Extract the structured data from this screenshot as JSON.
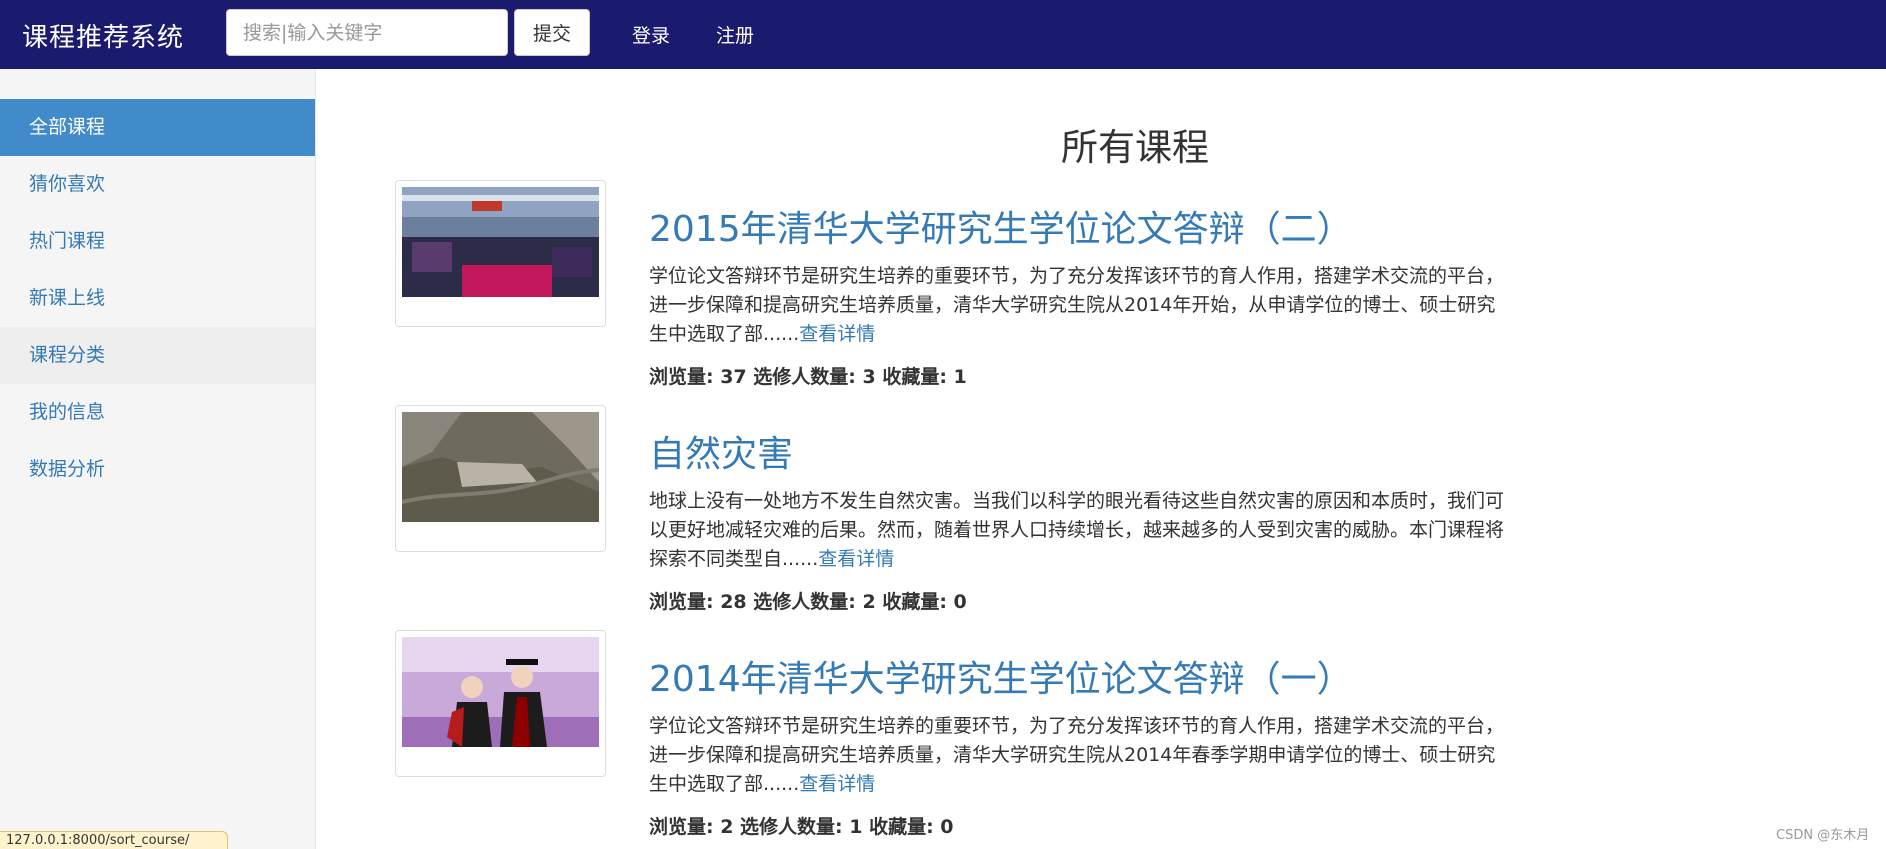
{
  "app": {
    "brand": "课程推荐系统"
  },
  "navbar": {
    "search_placeholder": "搜索|输入关键字",
    "submit_label": "提交",
    "login_label": "登录",
    "register_label": "注册"
  },
  "sidebar": {
    "items": [
      {
        "label": "全部课程",
        "state": "active"
      },
      {
        "label": "猜你喜欢",
        "state": "normal"
      },
      {
        "label": "热门课程",
        "state": "normal"
      },
      {
        "label": "新课上线",
        "state": "normal"
      },
      {
        "label": "课程分类",
        "state": "hover"
      },
      {
        "label": "我的信息",
        "state": "normal"
      },
      {
        "label": "数据分析",
        "state": "normal"
      }
    ]
  },
  "main": {
    "title": "所有课程",
    "more_label": "查看详情",
    "courses": [
      {
        "title": "2015年清华大学研究生学位论文答辩（二）",
        "description": "学位论文答辩环节是研究生培养的重要环节，为了充分发挥该环节的育人作用，搭建学术交流的平台，进一步保障和提高研究生培养质量，清华大学研究生院从2014年开始，从申请学位的博士、硕士研究生中选取了部......",
        "stats": "浏览量: 37 选修人数量: 3 收藏量: 1",
        "image": "graduation-ceremony-hall-photo"
      },
      {
        "title": "自然灾害",
        "description": "地球上没有一处地方不发生自然灾害。当我们以科学的眼光看待这些自然灾害的原因和本质时，我们可以更好地减轻灾难的后果。然而，随着世界人口持续增长，越来越多的人受到灾害的威胁。本门课程将探索不同类型自......",
        "stats": "浏览量: 28 选修人数量: 2 收藏量: 0",
        "image": "mountain-valley-aerial-photo"
      },
      {
        "title": "2014年清华大学研究生学位论文答辩（一）",
        "description": "学位论文答辩环节是研究生培养的重要环节，为了充分发挥该环节的育人作用，搭建学术交流的平台，进一步保障和提高研究生培养质量，清华大学研究生院从2014年春季学期申请学位的博士、硕士研究生中选取了部......",
        "stats": "浏览量: 2 选修人数量: 1 收藏量: 0",
        "image": "degree-conferral-photo"
      }
    ]
  },
  "statusbar": {
    "url": "127.0.0.1:8000/sort_course/"
  },
  "watermark": "CSDN @东木月",
  "colors": {
    "navbar": "#1a1a6e",
    "accent": "#337ab7",
    "active_item": "#428bca"
  }
}
